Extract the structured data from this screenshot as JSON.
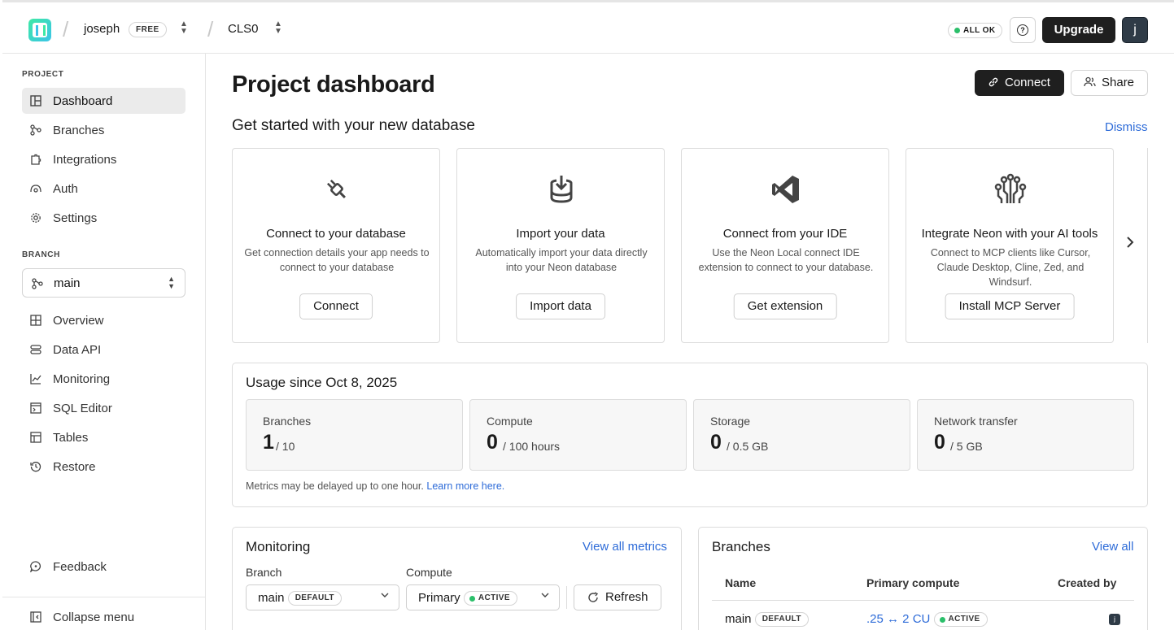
{
  "topbar": {
    "org_name": "joseph",
    "plan_badge": "FREE",
    "project_name": "CLS0",
    "status": "ALL OK",
    "help_icon": "question-circle-icon",
    "upgrade_label": "Upgrade",
    "avatar_initial": "j"
  },
  "sidebar": {
    "project_heading": "PROJECT",
    "project_items": [
      {
        "label": "Dashboard",
        "icon": "dashboard-icon",
        "active": true
      },
      {
        "label": "Branches",
        "icon": "branches-icon"
      },
      {
        "label": "Integrations",
        "icon": "puzzle-icon"
      },
      {
        "label": "Auth",
        "icon": "auth-icon"
      },
      {
        "label": "Settings",
        "icon": "gear-icon"
      }
    ],
    "branch_heading": "BRANCH",
    "branch_selected": "main",
    "branch_items": [
      {
        "label": "Overview",
        "icon": "grid-icon"
      },
      {
        "label": "Data API",
        "icon": "data-api-icon"
      },
      {
        "label": "Monitoring",
        "icon": "chart-line-icon"
      },
      {
        "label": "SQL Editor",
        "icon": "sql-editor-icon"
      },
      {
        "label": "Tables",
        "icon": "table-icon"
      },
      {
        "label": "Restore",
        "icon": "history-icon"
      }
    ],
    "feedback_label": "Feedback",
    "collapse_label": "Collapse menu"
  },
  "main": {
    "title": "Project dashboard",
    "connect_label": "Connect",
    "share_label": "Share",
    "get_started_title": "Get started with your new database",
    "dismiss_label": "Dismiss",
    "cards": [
      {
        "icon": "plug-icon",
        "title": "Connect to your database",
        "desc": "Get connection details your app needs to connect to your database",
        "button": "Connect"
      },
      {
        "icon": "import-database-icon",
        "title": "Import your data",
        "desc": "Automatically import your data directly into your Neon database",
        "button": "Import data"
      },
      {
        "icon": "vscode-icon",
        "title": "Connect from your IDE",
        "desc": "Use the Neon Local connect IDE extension to connect to your database.",
        "button": "Get extension"
      },
      {
        "icon": "circuit-icon",
        "title": "Integrate Neon with your AI tools",
        "desc": "Connect to MCP clients like Cursor, Claude Desktop, Cline, Zed, and Windsurf.",
        "button": "Install MCP Server"
      }
    ],
    "usage": {
      "title": "Usage since Oct 8, 2025",
      "stats": [
        {
          "label": "Branches",
          "value": "1",
          "limit": "/ 10"
        },
        {
          "label": "Compute",
          "value": "0",
          "limit": "/ 100 hours"
        },
        {
          "label": "Storage",
          "value": "0",
          "limit": "/ 0.5 GB"
        },
        {
          "label": "Network transfer",
          "value": "0",
          "limit": "/ 5 GB"
        }
      ],
      "note": "Metrics may be delayed up to one hour.",
      "note_link": "Learn more here."
    },
    "monitoring": {
      "title": "Monitoring",
      "link": "View all metrics",
      "branch_label": "Branch",
      "branch_value": "main",
      "branch_tag": "DEFAULT",
      "compute_label": "Compute",
      "compute_value": "Primary",
      "compute_tag": "ACTIVE",
      "refresh_label": "Refresh"
    },
    "branches": {
      "title": "Branches",
      "link": "View all",
      "columns": [
        "Name",
        "Primary compute",
        "Created by"
      ],
      "rows": [
        {
          "name": "main",
          "tag": "DEFAULT",
          "compute": ".25 ↔ 2 CU",
          "status": "ACTIVE",
          "created_by": "j"
        }
      ]
    }
  },
  "colors": {
    "accent_link": "#2d6bd8",
    "primary_button": "#1f1f1f",
    "status_green": "#2bbf6a"
  }
}
